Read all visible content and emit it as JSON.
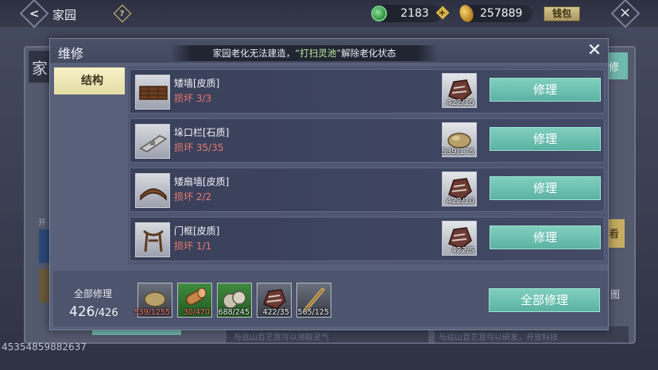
{
  "top_bar": {
    "title": "家园",
    "help_icon": "question-diamond-icon",
    "jade_value": "2183",
    "coin_value": "257889",
    "wallet_label": "钱包"
  },
  "background": {
    "left_tab_char": "家",
    "right_tab_char": "修",
    "gold_tab_char": "看",
    "side_label": "开",
    "bottom_text_1": "与远山百艺宫可以领取灵气",
    "bottom_text_2": "与远山百艺宫可以研发，开放科技",
    "player_id": "45354859882637",
    "right_char": "图"
  },
  "dialog": {
    "title": "维修",
    "side_tab": "结构",
    "tooltip_prefix": "家园老化无法建造，",
    "tooltip_highlight": "“打扫灵池”",
    "tooltip_suffix": "解除老化状态",
    "rows": [
      {
        "name": "矮墙[皮质]",
        "damage": "损坏 3/3",
        "material_count": "422/15",
        "button": "修理"
      },
      {
        "name": "垛口栏[石质]",
        "damage": "损坏 35/35",
        "material_count": "539/175",
        "button": "修理"
      },
      {
        "name": "矮扇墙[皮质]",
        "damage": "损坏 2/2",
        "material_count": "422/10",
        "button": "修理"
      },
      {
        "name": "门框[皮质]",
        "damage": "损坏 1/1",
        "material_count": "422/5",
        "button": "修理"
      }
    ],
    "bottom": {
      "total_label": "全部修理",
      "total_current": "426",
      "total_max": "/426",
      "materials": [
        "539/1255",
        "30/470",
        "688/245",
        "422/35",
        "565/125"
      ],
      "repair_all_label": "全部修理"
    }
  },
  "colors": {
    "repair_button": "#6cc2b2",
    "damage_text": "#e8786e",
    "tab_active": "#f2ecc0"
  }
}
